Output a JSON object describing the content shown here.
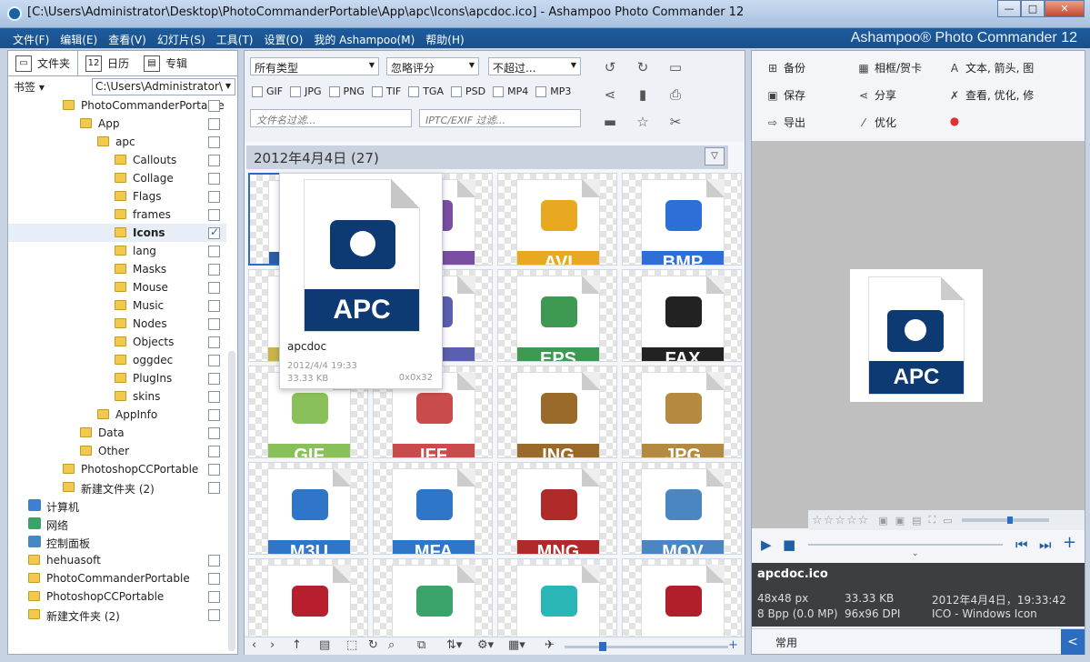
{
  "window": {
    "title": "[C:\\Users\\Administrator\\Desktop\\PhotoCommanderPortable\\App\\apc\\Icons\\apcdoc.ico] - Ashampoo Photo Commander 12",
    "min": "—",
    "max": "□",
    "close": "✕"
  },
  "menu": {
    "items": [
      "文件(F)",
      "编辑(E)",
      "查看(V)",
      "幻灯片(S)",
      "工具(T)",
      "设置(O)",
      "我的 Ashampoo(M)",
      "帮助(H)"
    ],
    "brand": "Ashampoo® Photo Commander 12"
  },
  "left": {
    "tabs": [
      "文件夹",
      "日历",
      "专辑"
    ],
    "tab_icons": [
      "folder-icon",
      "calendar-icon",
      "album-icon"
    ],
    "bookmarks": "书签",
    "path": "C:\\Users\\Administrator\\",
    "tree": [
      {
        "label": "PhotoCommanderPortable",
        "indent": 0,
        "type": "folder",
        "cb": true
      },
      {
        "label": "App",
        "indent": 1,
        "type": "folder",
        "cb": true
      },
      {
        "label": "apc",
        "indent": 2,
        "type": "folder",
        "cb": true
      },
      {
        "label": "Callouts",
        "indent": 3,
        "type": "folder",
        "cb": true
      },
      {
        "label": "Collage",
        "indent": 3,
        "type": "folder",
        "cb": true
      },
      {
        "label": "Flags",
        "indent": 3,
        "type": "folder",
        "cb": true
      },
      {
        "label": "frames",
        "indent": 3,
        "type": "folder",
        "cb": true
      },
      {
        "label": "Icons",
        "indent": 3,
        "type": "folder",
        "cb": true,
        "checked": true,
        "selected": true
      },
      {
        "label": "lang",
        "indent": 3,
        "type": "folder",
        "cb": true
      },
      {
        "label": "Masks",
        "indent": 3,
        "type": "folder",
        "cb": true
      },
      {
        "label": "Mouse",
        "indent": 3,
        "type": "folder",
        "cb": true
      },
      {
        "label": "Music",
        "indent": 3,
        "type": "folder",
        "cb": true
      },
      {
        "label": "Nodes",
        "indent": 3,
        "type": "folder",
        "cb": true
      },
      {
        "label": "Objects",
        "indent": 3,
        "type": "folder",
        "cb": true
      },
      {
        "label": "oggdec",
        "indent": 3,
        "type": "folder",
        "cb": true
      },
      {
        "label": "PlugIns",
        "indent": 3,
        "type": "folder",
        "cb": true
      },
      {
        "label": "skins",
        "indent": 3,
        "type": "folder",
        "cb": true
      },
      {
        "label": "AppInfo",
        "indent": 2,
        "type": "folder",
        "cb": true
      },
      {
        "label": "Data",
        "indent": 1,
        "type": "folder",
        "cb": true
      },
      {
        "label": "Other",
        "indent": 1,
        "type": "folder",
        "cb": true
      },
      {
        "label": "PhotoshopCCPortable",
        "indent": 0,
        "type": "folder",
        "cb": true
      },
      {
        "label": "新建文件夹 (2)",
        "indent": 0,
        "type": "folder",
        "cb": true
      },
      {
        "label": "计算机",
        "indent": -1,
        "type": "computer",
        "cb": false
      },
      {
        "label": "网络",
        "indent": -1,
        "type": "network",
        "cb": false
      },
      {
        "label": "控制面板",
        "indent": -1,
        "type": "control",
        "cb": false
      },
      {
        "label": "hehuasoft",
        "indent": -1,
        "type": "folder",
        "cb": true
      },
      {
        "label": "PhotoCommanderPortable",
        "indent": -1,
        "type": "folder",
        "cb": true
      },
      {
        "label": "PhotoshopCCPortable",
        "indent": -1,
        "type": "folder",
        "cb": true
      },
      {
        "label": "新建文件夹 (2)",
        "indent": -1,
        "type": "folder",
        "cb": true
      }
    ]
  },
  "center": {
    "filter_type": "所有类型",
    "filter_rating": "忽略评分",
    "filter_limit": "不超过...",
    "types": [
      "GIF",
      "JPG",
      "PNG",
      "TIF",
      "TGA",
      "PSD",
      "MP4",
      "MP3"
    ],
    "filename_placeholder": "文件名过滤...",
    "exif_placeholder": "IPTC/EXIF 过滤...",
    "toolbar_icons": [
      "rotate-left-icon",
      "rotate-right-icon",
      "screen-icon",
      "share-icon",
      "document-icon",
      "print-icon",
      "box-icon",
      "star-icon",
      "cut-icon"
    ],
    "date_header": "2012年4月4日 (27)",
    "thumbs": [
      {
        "label": "",
        "color": "#2b5ea7"
      },
      {
        "label": "E",
        "color": "#7a4ea3"
      },
      {
        "label": "AVI",
        "color": "#e8a820"
      },
      {
        "label": "BMP",
        "color": "#2d6fd6"
      },
      {
        "label": "",
        "color": "#c9b34a"
      },
      {
        "label": "E",
        "color": "#5a5fb0"
      },
      {
        "label": "EPS",
        "color": "#3e9a52"
      },
      {
        "label": "FAX",
        "color": "#222222"
      },
      {
        "label": "GIF",
        "color": "#8ac05a"
      },
      {
        "label": "IFF",
        "color": "#c94b4b"
      },
      {
        "label": "ING",
        "color": "#9a6a2a"
      },
      {
        "label": "JPG",
        "color": "#b38a40"
      },
      {
        "label": "M3U",
        "color": "#2f76c9"
      },
      {
        "label": "MFA",
        "color": "#2f76c9"
      },
      {
        "label": "MNG",
        "color": "#b02a2a"
      },
      {
        "label": "MOV",
        "color": "#4a86c2"
      },
      {
        "label": "",
        "color": "#b81f2e"
      },
      {
        "label": "",
        "color": "#3aa36a"
      },
      {
        "label": "",
        "color": "#2ab6b6"
      },
      {
        "label": "",
        "color": "#b01f2a"
      }
    ],
    "popup": {
      "name": "apcdoc",
      "date": "2012/4/4 19:33",
      "size": "33.33 KB",
      "dims": "0x0x32",
      "ghost": "ICO",
      "doc_label": "APC"
    }
  },
  "right": {
    "actions": [
      {
        "label": "备份",
        "icon": "backup-icon"
      },
      {
        "label": "相框/贺卡",
        "icon": "frame-icon"
      },
      {
        "label": "文本, 箭头, 图",
        "icon": "text-icon"
      },
      {
        "label": "保存",
        "icon": "save-icon"
      },
      {
        "label": "分享",
        "icon": "share-icon"
      },
      {
        "label": "查看, 优化, 修",
        "icon": "tools-icon"
      },
      {
        "label": "导出",
        "icon": "export-icon"
      },
      {
        "label": "优化",
        "icon": "wand-icon"
      },
      {
        "label": "",
        "icon": "color-icon"
      },
      {
        "label": "",
        "icon": "resize-icon"
      },
      {
        "label": "",
        "icon": "crop-icon"
      }
    ],
    "preview_label": "APC",
    "rating": "☆☆☆☆☆",
    "filename": "apcdoc.ico",
    "info": [
      [
        "48x48 px",
        "33.33 KB",
        "2012年4月4日，19:33:42"
      ],
      [
        "8 Bpp (0.0 MP)",
        "96x96 DPI",
        "ICO - Windows Icon"
      ]
    ],
    "common": "常用",
    "common_arrow": "<"
  }
}
